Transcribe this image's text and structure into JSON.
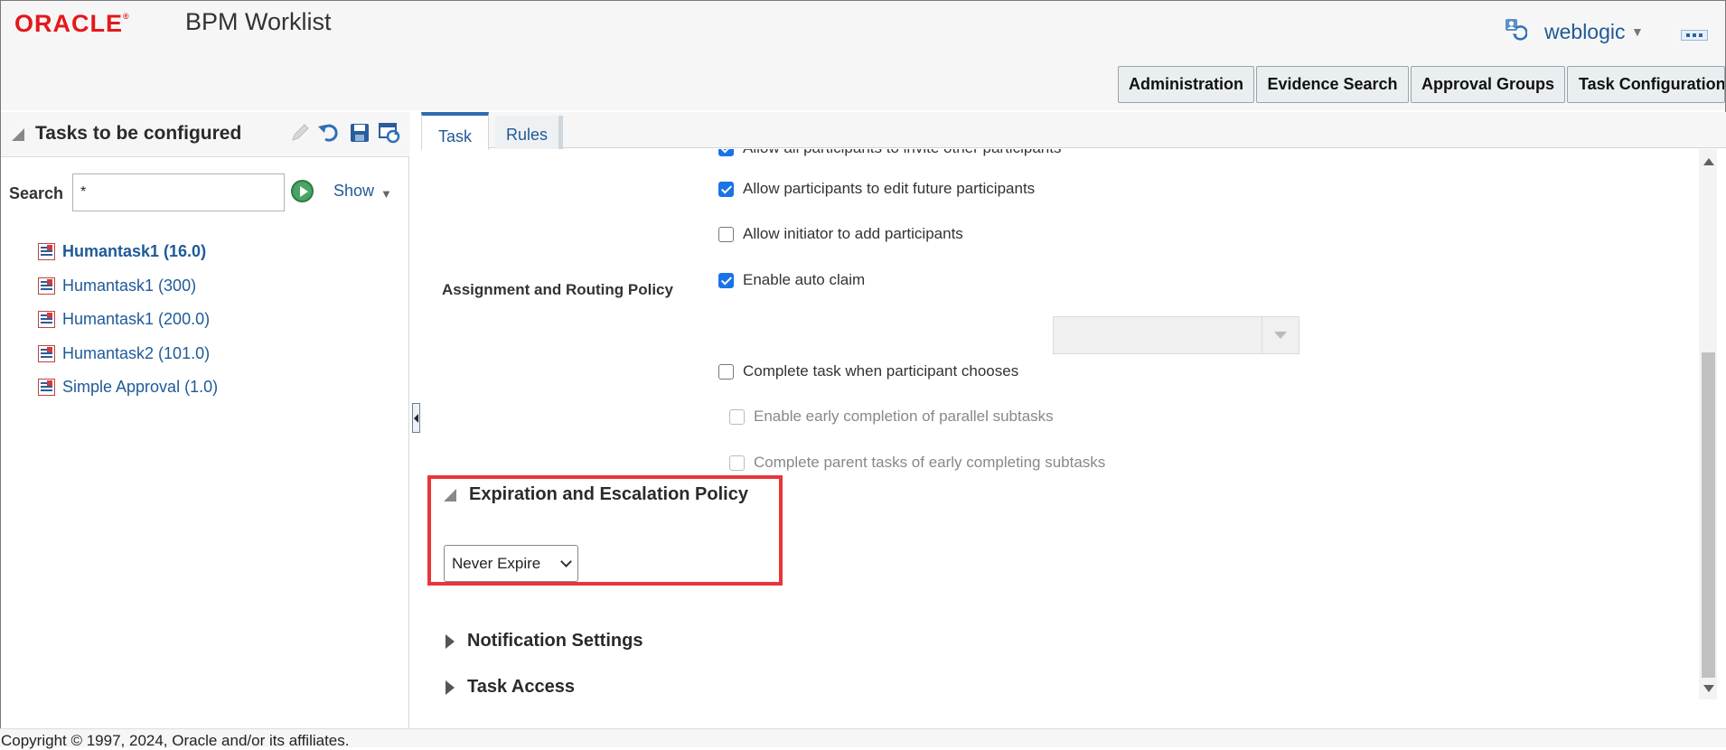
{
  "header": {
    "logo_text": "ORACLE",
    "logo_mark": "®",
    "app_title": "BPM Worklist",
    "user_name": "weblogic",
    "user_caret": "▼",
    "user_icon": "refresh-user-icon",
    "more_icon": "more-dots-icon"
  },
  "top_buttons": [
    {
      "label": "Administration"
    },
    {
      "label": "Evidence Search"
    },
    {
      "label": "Approval Groups"
    },
    {
      "label": "Task Configuration"
    }
  ],
  "left_panel": {
    "title": "Tasks to be configured",
    "tools": [
      "edit-icon",
      "undo-icon",
      "save-icon",
      "refresh-icon"
    ],
    "search_label": "Search",
    "search_value": "*",
    "show_label": "Show",
    "show_caret": "▼",
    "tasks": [
      {
        "label": "Humantask1 (16.0)",
        "selected": true
      },
      {
        "label": "Humantask1 (300)",
        "selected": false
      },
      {
        "label": "Humantask1 (200.0)",
        "selected": false
      },
      {
        "label": "Humantask2 (101.0)",
        "selected": false
      },
      {
        "label": "Simple Approval (1.0)",
        "selected": false
      }
    ]
  },
  "tabs": [
    {
      "label": "Task",
      "active": true
    },
    {
      "label": "Rules",
      "active": false
    }
  ],
  "assignment": {
    "label": "Assignment and Routing Policy",
    "options": [
      {
        "label": "Allow all participants to invite other participants",
        "checked": true,
        "disabled": false
      },
      {
        "label": "Allow participants to edit future participants",
        "checked": true,
        "disabled": false
      },
      {
        "label": "Allow initiator to add participants",
        "checked": false,
        "disabled": false
      },
      {
        "label": "Enable auto claim",
        "checked": true,
        "disabled": false
      },
      {
        "label": "Complete task when participant chooses",
        "checked": false,
        "disabled": false
      },
      {
        "label": "Enable early completion of parallel subtasks",
        "checked": false,
        "disabled": true
      },
      {
        "label": "Complete parent tasks of early completing subtasks",
        "checked": false,
        "disabled": true
      }
    ]
  },
  "expiration": {
    "title": "Expiration and Escalation Policy",
    "selected": "Never Expire",
    "highlight_color": "#e8353b"
  },
  "sections": [
    {
      "title": "Notification Settings",
      "expanded": false
    },
    {
      "title": "Task Access",
      "expanded": false
    }
  ],
  "footer": {
    "copyright": "Copyright © 1997, 2024, Oracle and/or its affiliates."
  },
  "colors": {
    "brand": "#e4181c",
    "link": "#1f5a98",
    "checkbox": "#1a73e8"
  }
}
